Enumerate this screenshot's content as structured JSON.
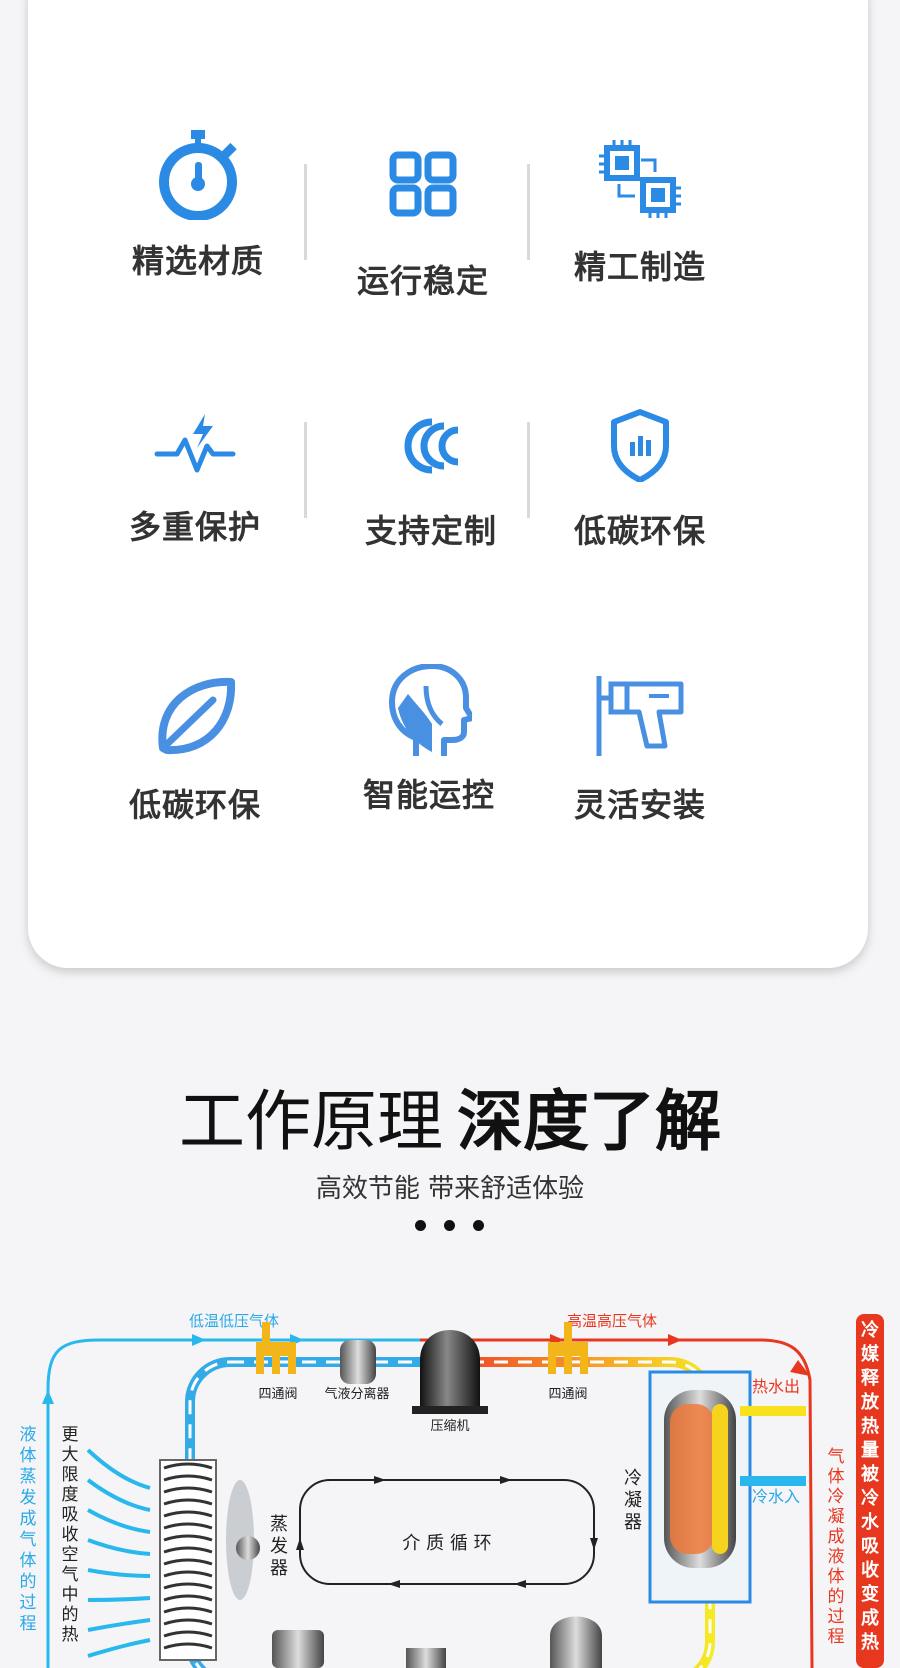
{
  "features": [
    {
      "label": "精选材质",
      "icon": "stopwatch-icon"
    },
    {
      "label": "运行稳定",
      "icon": "grid-icon"
    },
    {
      "label": "精工制造",
      "icon": "chip-icon"
    },
    {
      "label": "多重保护",
      "icon": "pulse-icon"
    },
    {
      "label": "支持定制",
      "icon": "ccc-icon"
    },
    {
      "label": "低碳环保",
      "icon": "shield-icon"
    },
    {
      "label": "低碳环保",
      "icon": "leaf-icon"
    },
    {
      "label": "智能运控",
      "icon": "head-icon"
    },
    {
      "label": "灵活安装",
      "icon": "drill-icon"
    }
  ],
  "section": {
    "title_light": "工作原理",
    "title_bold": "深度了解",
    "subtitle": "高效节能 带来舒适体验"
  },
  "diagram": {
    "low_gas": "低温低压气体",
    "high_gas": "高温高压气体",
    "valve_left": "四通阀",
    "separator": "气液分离器",
    "compressor": "压缩机",
    "valve_right": "四通阀",
    "evaporator": "蒸发器",
    "condenser": "冷凝器",
    "cycle": "介 质 循 环",
    "hot_out": "热水出",
    "cold_in": "冷水入",
    "left_process": "液体蒸发成气体的过程",
    "left_absorb": "更大限度吸收空气中的热",
    "right_process": "气体冷凝成液体的过程",
    "right_release": "冷媒释放热量被冷水吸收变成热"
  },
  "colors": {
    "icon_blue": "#2a8ae4",
    "cold_blue": "#29a9e8",
    "hot_red": "#e8371f",
    "hot_orange": "#f5a10f"
  }
}
